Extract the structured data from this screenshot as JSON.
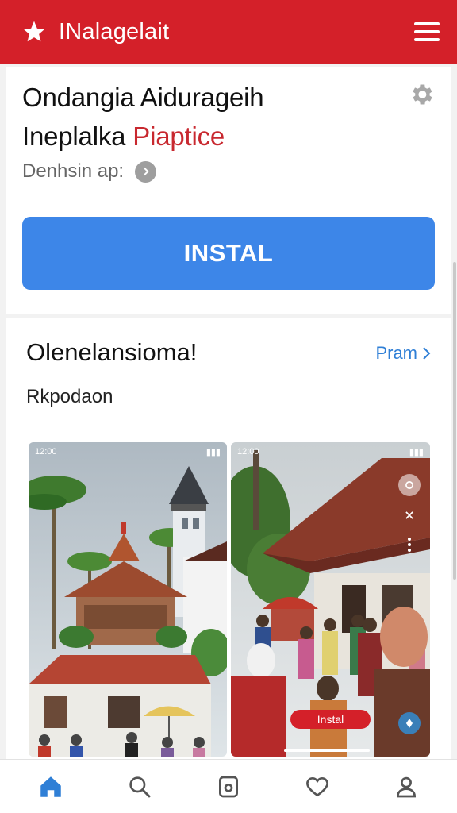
{
  "header": {
    "brand": "INalagelait",
    "bg_color": "#d42029",
    "icons": [
      "star-icon",
      "menu-icon"
    ]
  },
  "app": {
    "title_line1": "Ondangia Aidurageih",
    "title_line2_main": "Ineplalka",
    "title_line2_accent": "Piaptice",
    "developer_label": "Denhsin ap:",
    "install_label": "INSTAL",
    "install_color": "#3d86e8",
    "settings_icon": "gear-icon"
  },
  "section": {
    "title": "Olenelansioma!",
    "more_label": "Pram",
    "subtitle": "Rkpodaon"
  },
  "screenshots": [
    {
      "status_left": "12:00",
      "status_right": "▮▮▮"
    },
    {
      "status_left": "12:00",
      "status_right": "▮▮▮",
      "overlay_button": "Instal"
    }
  ],
  "bottom_nav": [
    {
      "name": "home",
      "icon": "home-icon",
      "active": true
    },
    {
      "name": "search",
      "icon": "search-icon",
      "active": false
    },
    {
      "name": "apps",
      "icon": "apps-icon",
      "active": false
    },
    {
      "name": "favorites",
      "icon": "heart-icon",
      "active": false
    },
    {
      "name": "profile",
      "icon": "profile-icon",
      "active": false
    }
  ]
}
